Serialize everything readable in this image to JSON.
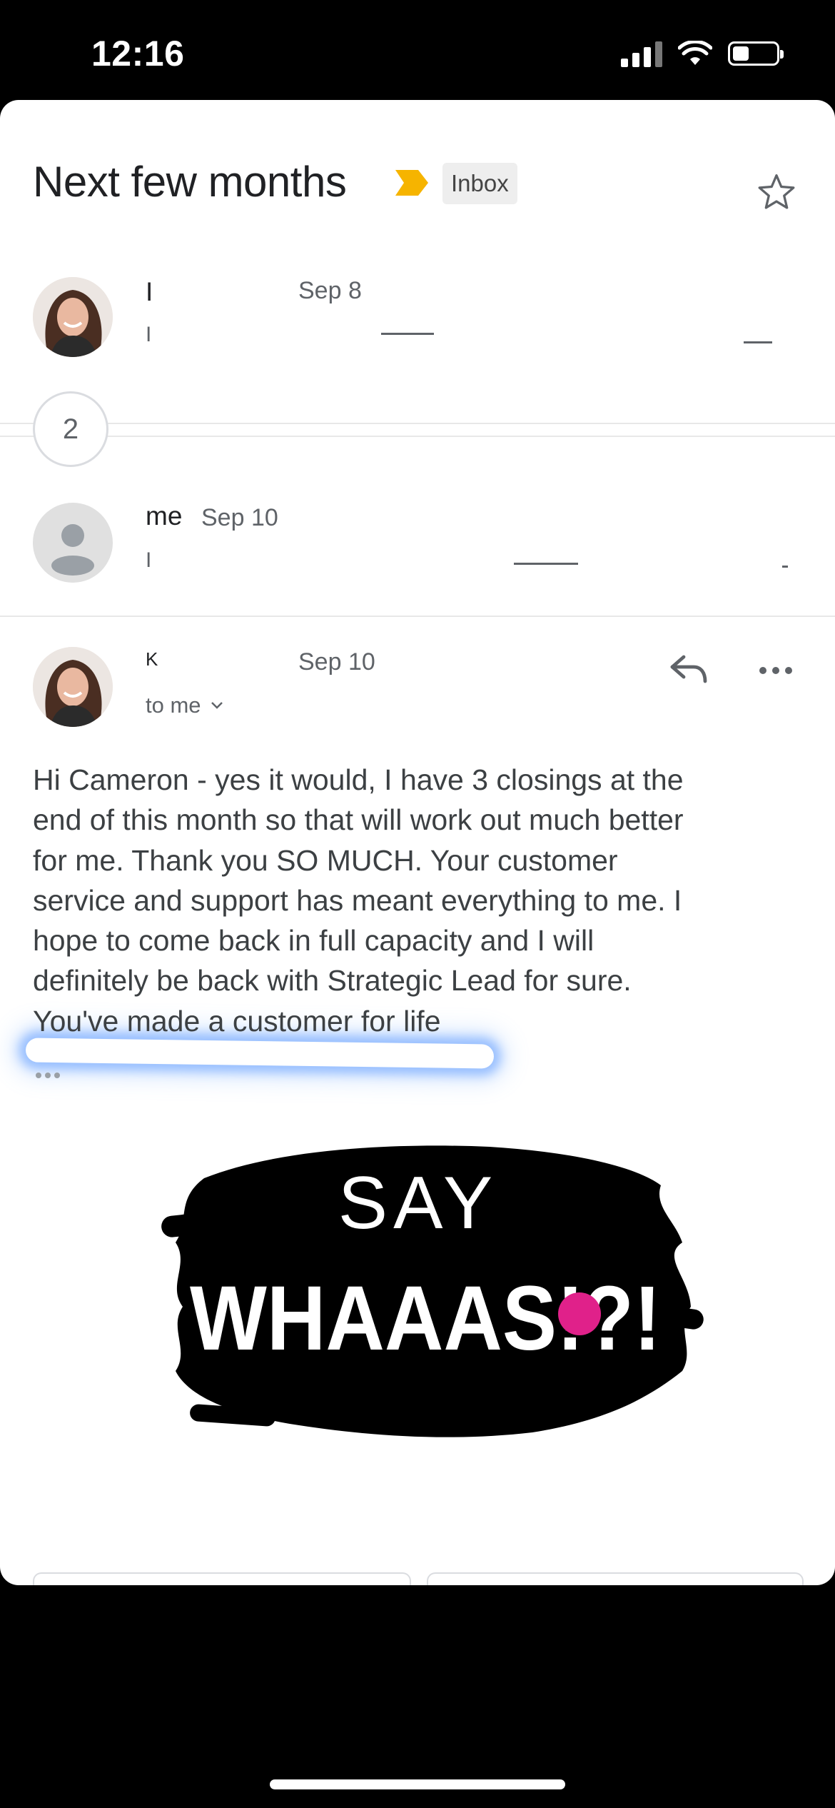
{
  "status_bar": {
    "time": "12:16"
  },
  "thread": {
    "subject": "Next few months",
    "label": "Inbox",
    "collapsed_count": "2"
  },
  "messages": [
    {
      "sender": "I",
      "date": "Sep 8",
      "snippet": "I"
    },
    {
      "sender": "me",
      "date": "Sep 10",
      "snippet": "I"
    },
    {
      "sender": "K",
      "date": "Sep 10",
      "recipient": "to me",
      "body_lines": [
        "Hi Cameron - yes it would, I have 3 closings at the",
        "end of this month so that will work out much better",
        "for me.  Thank you SO MUCH.  Your customer",
        "service and support has meant everything to me.  I",
        "hope to come back in full capacity and I will",
        "definitely be back with Strategic Lead for sure.",
        "You've made a customer for life"
      ]
    }
  ],
  "sticker": {
    "line1": "SAY",
    "line2": "WHAAAS!?!"
  },
  "colors": {
    "importance": "#f6b400",
    "highlight": "#4a90ff",
    "sticker_accent": "#e0218a"
  }
}
